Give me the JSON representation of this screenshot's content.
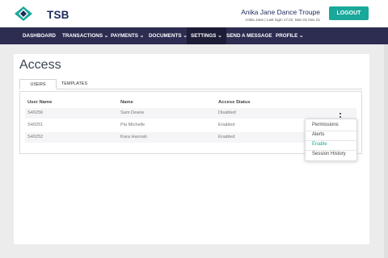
{
  "brand": {
    "name": "TSB",
    "mark_color": "#1aa89a",
    "text_color": "#1d2a5c"
  },
  "header": {
    "org_name": "Anika Jane Dance Troupe",
    "login_info": "Anika Jane | Last login 17:22, Mon 01 Nov 21",
    "logout_label": "LOGOUT"
  },
  "nav": {
    "items": [
      {
        "label": "DASHBOARD"
      },
      {
        "label": "TRANSACTIONS ⌄"
      },
      {
        "label": "PAYMENTS ⌄"
      },
      {
        "label": "DOCUMENTS ⌄"
      },
      {
        "label": "SETTINGS ⌄"
      },
      {
        "label": "SEND A MESSAGE"
      },
      {
        "label": "PROFILE ⌄"
      }
    ],
    "active": "SETTINGS"
  },
  "page": {
    "title": "Access",
    "tabs": [
      {
        "label": "USERS"
      },
      {
        "label": "TEMPLATES"
      }
    ],
    "active_tab": "USERS"
  },
  "table": {
    "headers": [
      "User Name",
      "Name",
      "Access Status"
    ],
    "rows": [
      [
        "S40256",
        "Sam Deane",
        "Disabled"
      ],
      [
        "S40251",
        "Pia Michelle",
        "Enabled"
      ],
      [
        "S40252",
        "Kara Hannah",
        "Enabled"
      ]
    ]
  },
  "row_menu": {
    "items": [
      {
        "label": "Permissions"
      },
      {
        "label": "Alerts"
      },
      {
        "label": "Enable"
      },
      {
        "label": "Session History"
      }
    ],
    "highlighted": "Enable"
  },
  "colors": {
    "accent": "#1aa89a",
    "navbar": "#2d2d52",
    "navbar_active": "#1d1d38"
  }
}
